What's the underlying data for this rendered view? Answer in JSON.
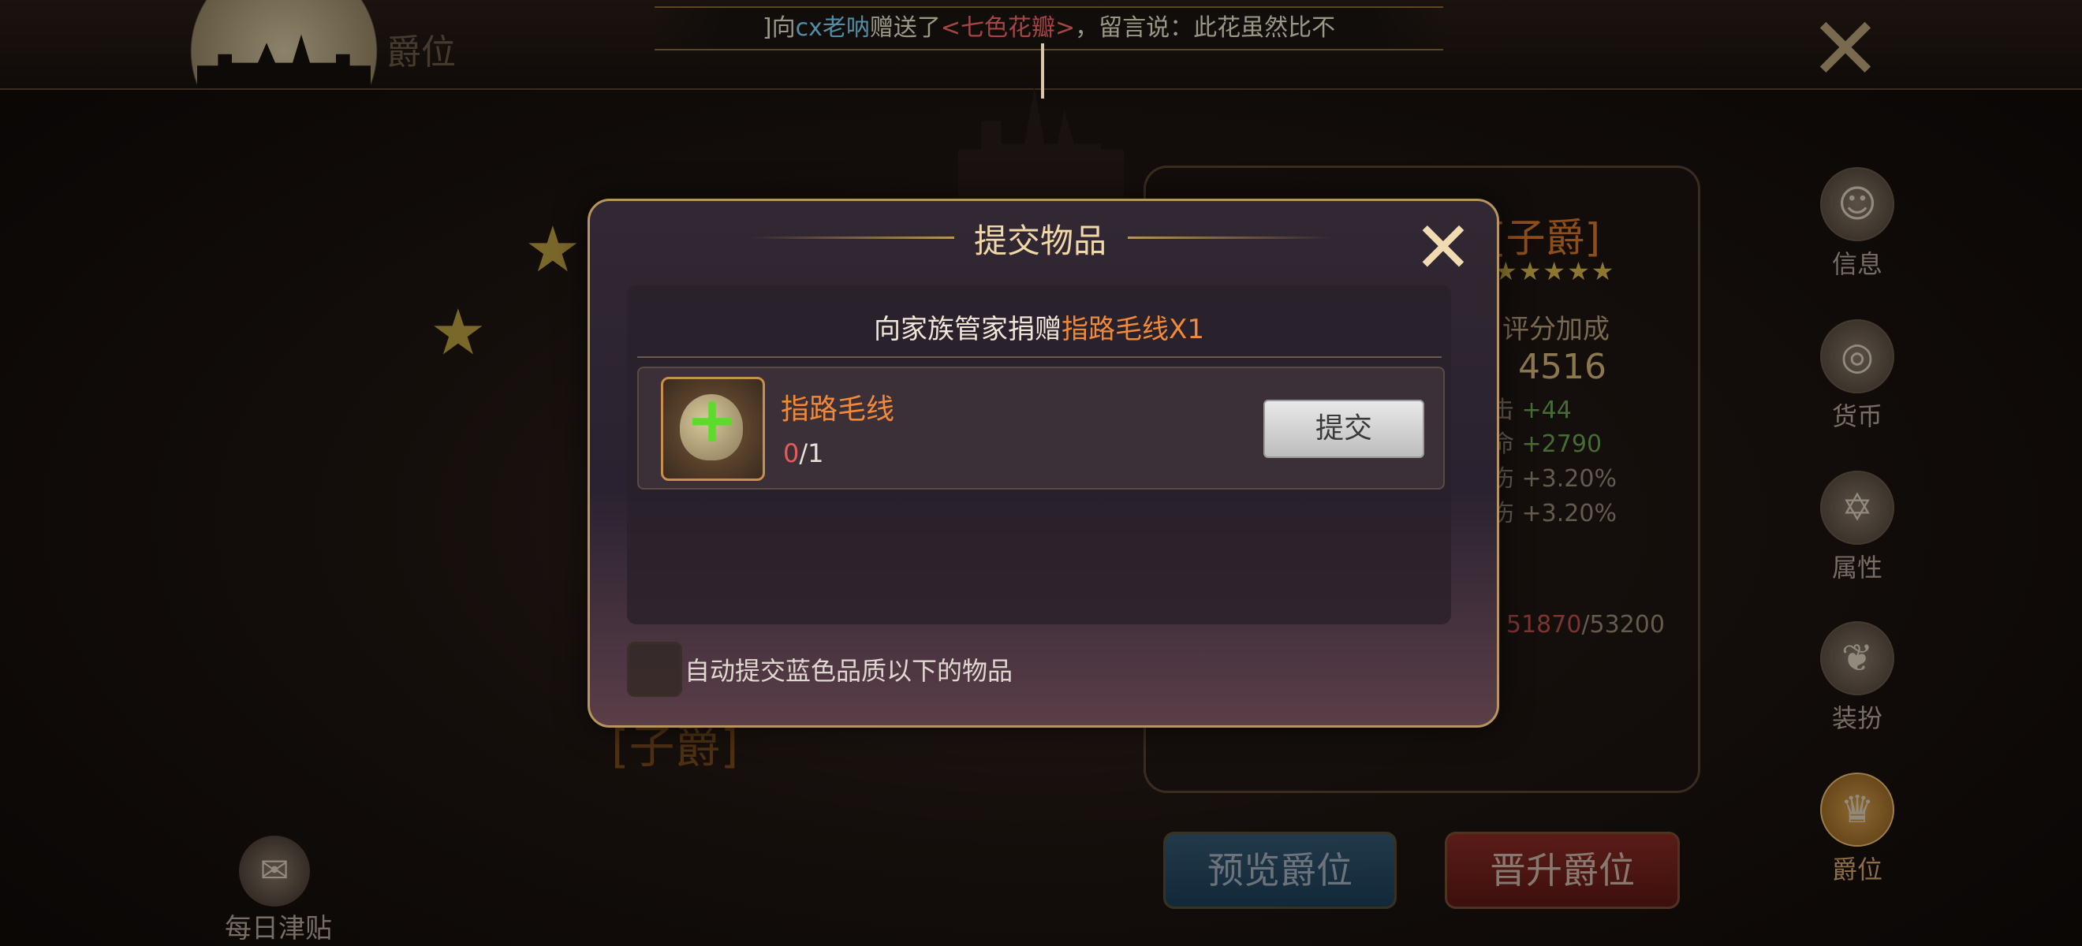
{
  "page_title": "爵位",
  "marquee": {
    "prefix": "]向",
    "sender": "cx老呐",
    "action": "赠送了",
    "gift": "<七色花瓣>",
    "message": "，留言说：此花虽然比不"
  },
  "background": {
    "rank_title": "[子爵]",
    "rank_stars": "★★★★★",
    "score_label": "评分加成",
    "score_value": "4516",
    "stats": [
      {
        "label": "攻击",
        "value": "+44"
      },
      {
        "label": "生命",
        "value": "+2790"
      },
      {
        "label": "增伤",
        "value": "+3.20%"
      },
      {
        "label": "减伤",
        "value": "+3.20%"
      }
    ],
    "hp_current": "51870",
    "hp_max": "/53200",
    "rank_title_left": "[子爵]"
  },
  "sidebar": {
    "items": [
      {
        "label": "信息",
        "icon": "person-icon",
        "glyph": "☺"
      },
      {
        "label": "货币",
        "icon": "coins-icon",
        "glyph": "◎"
      },
      {
        "label": "属性",
        "icon": "hexagram-icon",
        "glyph": "✡"
      },
      {
        "label": "装扮",
        "icon": "costume-icon",
        "glyph": "❦"
      },
      {
        "label": "爵位",
        "icon": "crest-icon",
        "glyph": "♛"
      }
    ]
  },
  "bottom": {
    "preview_label": "预览爵位",
    "promote_label": "晋升爵位",
    "daily_label": "每日津贴"
  },
  "dialog": {
    "title": "提交物品",
    "instruction_prefix": "向家族管家捐赠",
    "instruction_item": "指路毛线X1",
    "item_name": "指路毛线",
    "item_have": "0",
    "item_need": "/1",
    "submit_label": "提交",
    "auto_submit_label": "自动提交蓝色品质以下的物品",
    "auto_submit_checked": false
  },
  "colors": {
    "accent_orange": "#f08a3a",
    "gold": "#f0d8a8",
    "count_red": "#e85a5a"
  }
}
